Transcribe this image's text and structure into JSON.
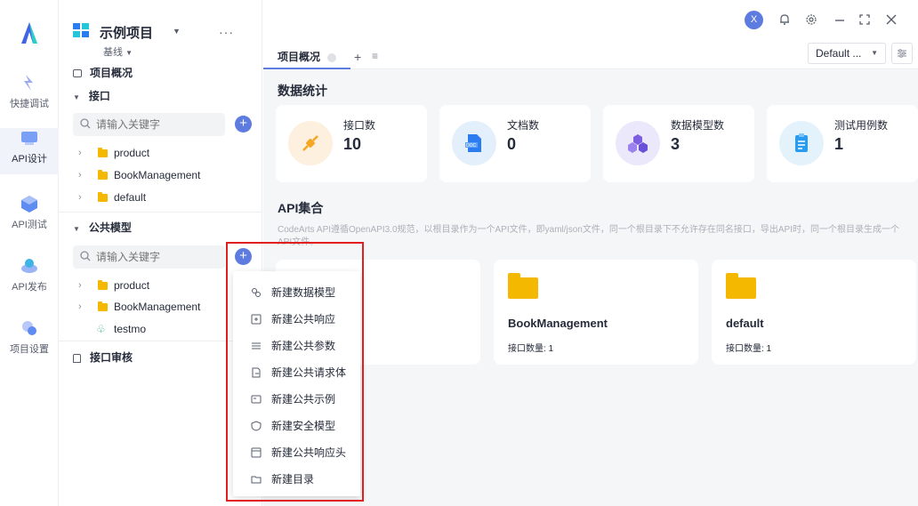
{
  "rail": {
    "items": [
      {
        "label": "快捷调试",
        "icon": "quick-debug-icon"
      },
      {
        "label": "API设计",
        "icon": "api-design-icon",
        "active": true
      },
      {
        "label": "API测试",
        "icon": "api-test-icon"
      },
      {
        "label": "API发布",
        "icon": "api-publish-icon"
      },
      {
        "label": "项目设置",
        "icon": "project-settings-icon"
      }
    ]
  },
  "project": {
    "name": "示例项目",
    "baseline": "基线"
  },
  "tree": {
    "overview": "项目概况",
    "interfaces_label": "接口",
    "search_placeholder": "请输入关键字",
    "interface_folders": [
      "product",
      "BookManagement",
      "default"
    ],
    "models_label": "公共模型",
    "model_items": [
      "product",
      "BookManagement",
      "testmo"
    ],
    "review_label": "接口审核"
  },
  "header": {
    "avatar_letter": "X"
  },
  "tabs": {
    "active": "项目概况",
    "env": "Default ..."
  },
  "stats": {
    "title": "数据统计",
    "cards": [
      {
        "label": "接口数",
        "value": "10",
        "icon": "plug-icon",
        "color": "#fdf0de"
      },
      {
        "label": "文档数",
        "value": "0",
        "icon": "doc-icon",
        "color": "#e4effc"
      },
      {
        "label": "数据模型数",
        "value": "3",
        "icon": "cubes-icon",
        "color": "#ece8fb"
      },
      {
        "label": "测试用例数",
        "value": "1",
        "icon": "clipboard-icon",
        "color": "#e4f2fc"
      }
    ]
  },
  "collections": {
    "title": "API集合",
    "desc": "CodeArts API遵循OpenAPI3.0规范，以根目录作为一个API文件，即yaml/json文件，同一个根目录下不允许存在同名接口，导出API时，同一个根目录生成一个API文件。",
    "cards": [
      {
        "name": "BookManagement",
        "count": "接口数量: 1"
      },
      {
        "name": "default",
        "count": "接口数量: 1"
      }
    ]
  },
  "menu": {
    "items": [
      {
        "label": "新建数据模型",
        "icon": "model-icon"
      },
      {
        "label": "新建公共响应",
        "icon": "response-icon"
      },
      {
        "label": "新建公共参数",
        "icon": "params-icon"
      },
      {
        "label": "新建公共请求体",
        "icon": "request-body-icon"
      },
      {
        "label": "新建公共示例",
        "icon": "example-icon"
      },
      {
        "label": "新建安全模型",
        "icon": "security-icon"
      },
      {
        "label": "新建公共响应头",
        "icon": "response-header-icon"
      },
      {
        "label": "新建目录",
        "icon": "folder-icon"
      }
    ]
  },
  "colors": {
    "accent": "#5e7ce0",
    "highlight": "#e02020",
    "folder": "#f5b800"
  }
}
